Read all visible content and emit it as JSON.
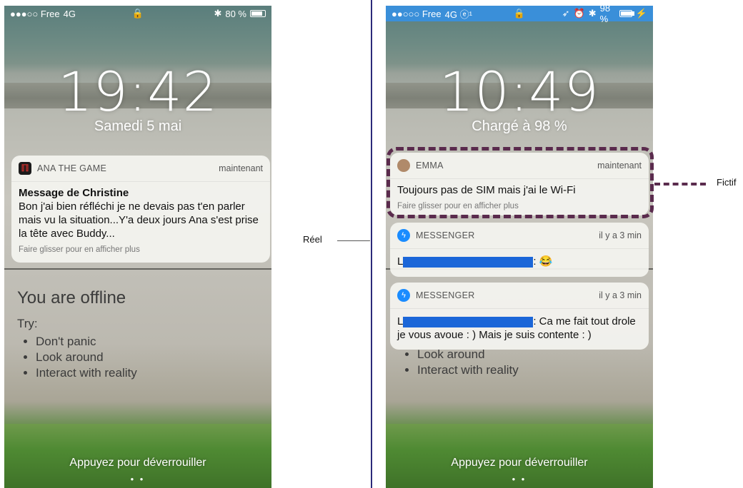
{
  "left_phone": {
    "status": {
      "carrier": "●●●○○ Free",
      "network": "4G",
      "lock": "🔒",
      "bluetooth": "✱",
      "battery": "80 %",
      "battery_level": 0.8
    },
    "time": "19:42",
    "date": "Samedi 5 mai",
    "notification": {
      "app": "ANA THE GAME",
      "when": "maintenant",
      "title": "Message de Christine",
      "text": "Bon j'ai bien réfléchi je ne devais pas t'en parler mais vu la situation...Y'a deux jours Ana s'est prise la tête avec Buddy...",
      "hint": "Faire glisser pour en afficher plus"
    },
    "wallpaper_text": {
      "heading": "You are offline",
      "try": "Try:",
      "items": [
        "Don't panic",
        "Look around",
        "Interact with reality"
      ]
    },
    "unlock": "Appuyez pour déverrouiller"
  },
  "right_phone": {
    "status": {
      "carrier": "●●○○○ Free",
      "network": "4G ⓔ¹",
      "lock": "🔒",
      "location": "➶",
      "alarm": "⏰",
      "bluetooth": "✱",
      "battery": "98 %",
      "battery_level": 0.98,
      "charging": "⚡"
    },
    "time": "10:49",
    "date": "Chargé à 98 %",
    "notifications": [
      {
        "app": "EMMA",
        "when": "maintenant",
        "text": "Toujours pas de SIM mais j'ai le Wi-Fi",
        "hint": "Faire glisser pour en afficher plus"
      },
      {
        "app": "MESSENGER",
        "when": "il y a 3 min",
        "prefix": "L",
        "suffix": ": 😂"
      },
      {
        "app": "MESSENGER",
        "when": "il y a 3 min",
        "prefix": "L",
        "suffix": ": Ca me fait tout drole je vous avoue  : ) Mais je suis contente  : )"
      }
    ],
    "wallpaper_text": {
      "items": [
        "Look around",
        "Interact with reality"
      ]
    },
    "unlock": "Appuyez pour déverrouiller"
  },
  "annotations": {
    "reel": "Réel",
    "fictif": "Fictif"
  },
  "colors": {
    "divider": "#2c2a7a",
    "fictif_border": "#5a2b4d",
    "redaction": "#1b66d8",
    "messenger": "#1a8cff"
  }
}
